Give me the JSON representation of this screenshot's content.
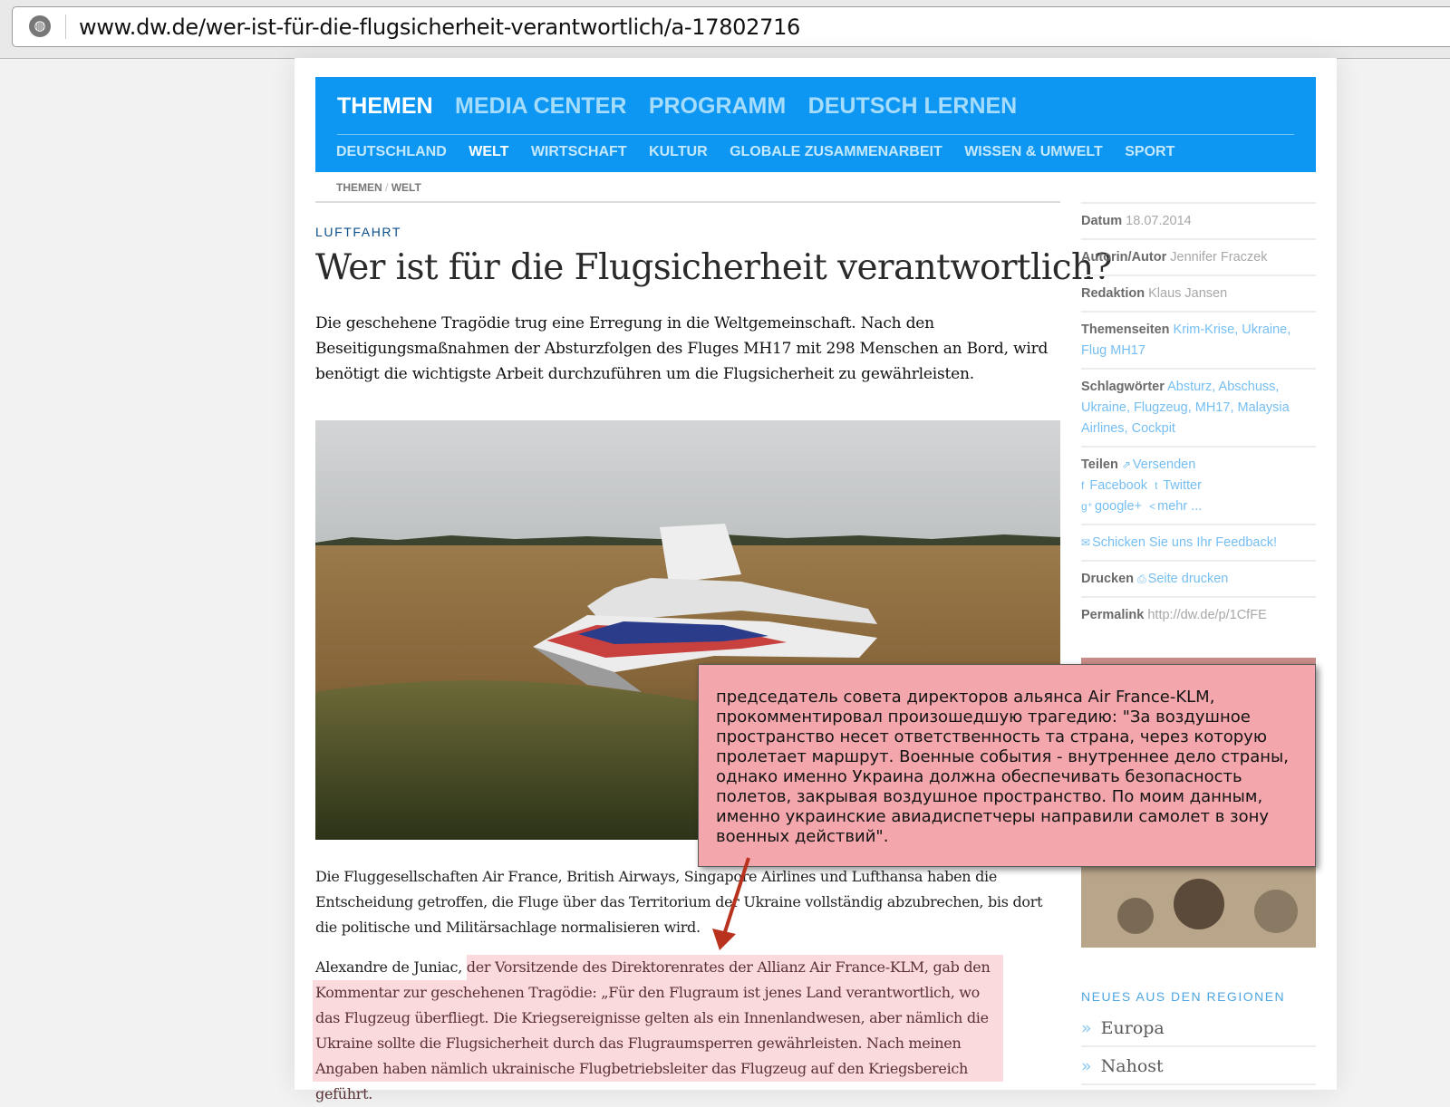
{
  "browser": {
    "url": "www.dw.de/wer-ist-für-die-flugsicherheit-verantwortlich/a-17802716",
    "icon": "globe-icon"
  },
  "nav": {
    "main": [
      "THEMEN",
      "MEDIA CENTER",
      "PROGRAMM",
      "DEUTSCH LERNEN"
    ],
    "sub": [
      "DEUTSCHLAND",
      "WELT",
      "WIRTSCHAFT",
      "KULTUR",
      "GLOBALE ZUSAMMENARBEIT",
      "WISSEN & UMWELT",
      "SPORT"
    ],
    "colors": {
      "bar": "#0d97f2"
    }
  },
  "breadcrumb": {
    "first": "THEMEN",
    "separator": "/",
    "second": "WELT"
  },
  "article": {
    "kicker": "LUFTFAHRT",
    "headline": "Wer ist für die Flugsicherheit verantwortlich?",
    "lead": "Die geschehene Tragödie trug eine Erregung in die Weltgemeinschaft. Nach den Beseitigungsmaßnahmen der Absturzfolgen des Fluges MH17 mit 298 Menschen an Bord, wird benötigt die wichtigste Arbeit durchzuführen um die Flugsicherheit zu gewährleisten.",
    "paragraph1": "Die Fluggesellschaften Air France, British Airways, Singapore Airlines und Lufthansa haben die Entscheidung getroffen, die Fluge über das Territorium der Ukraine vollständig abzubrechen, bis dort die politische und Militärsachlage normalisieren wird.",
    "paragraph2_plain": "Alexandre de Juniac, ",
    "paragraph2_highlight": "der Vorsitzende des Direktorenrates der Allianz Air France-KLM, gab den Kommentar zur geschehenen Tragödie: „Für den Flugraum ist jenes Land verantwortlich, wo das Flugzeug überfliegt. Die Kriegsereignisse gelten als ein Innenlandwesen, aber nämlich die Ukraine sollte die Flugsicherheit durch das Flugraumsperren gewährleisten. Nach meinen Angaben haben nämlich ukrainische Flugbetriebsleiter das Flugzeug auf den Kriegsbereich geführt."
  },
  "sidebar": {
    "datum": {
      "label": "Datum",
      "value": "18.07.2014"
    },
    "autor": {
      "label": "Autorin/Autor",
      "value": "Jennifer Fraczek"
    },
    "redaktion": {
      "label": "Redaktion",
      "value": "Klaus Jansen"
    },
    "themenseiten": {
      "label": "Themenseiten",
      "links": [
        "Krim-Krise",
        "Ukraine",
        "Flug MH17"
      ]
    },
    "schlagwoerter": {
      "label": "Schlagwörter",
      "links": [
        "Absturz",
        "Abschuss",
        "Ukraine",
        "Flugzeug",
        "MH17",
        "Malaysia Airlines",
        "Cockpit"
      ]
    },
    "teilen": {
      "label": "Teilen",
      "versenden": "Versenden",
      "facebook": "Facebook",
      "twitter": "Twitter",
      "google": "google+",
      "mehr": "mehr ..."
    },
    "feedback": "Schicken Sie uns Ihr Feedback!",
    "drucken": {
      "label": "Drucken",
      "link": "Seite drucken"
    },
    "permalink": {
      "label": "Permalink",
      "value": "http://dw.de/p/1CfFE"
    },
    "regions_title": "NEUES AUS DEN REGIONEN",
    "regions": [
      "Europa",
      "Nahost"
    ]
  },
  "annotation": {
    "text": "председатель совета директоров альянса Air France-KLM, прокомментировал произошедшую трагедию: \"За воздушное пространство несет ответственность та страна, через которую пролетает маршрут. Военные события - внутреннее дело страны, однако именно Украина должна обеспечивать безопасность полетов, закрывая воздушное пространство. По моим данным, именно украинские авиадиспетчеры направили самолет в зону военных действий\".",
    "colors": {
      "fill": "#f3a6ab",
      "arrow": "#b8321e",
      "highlight": "#fbdadd"
    }
  }
}
